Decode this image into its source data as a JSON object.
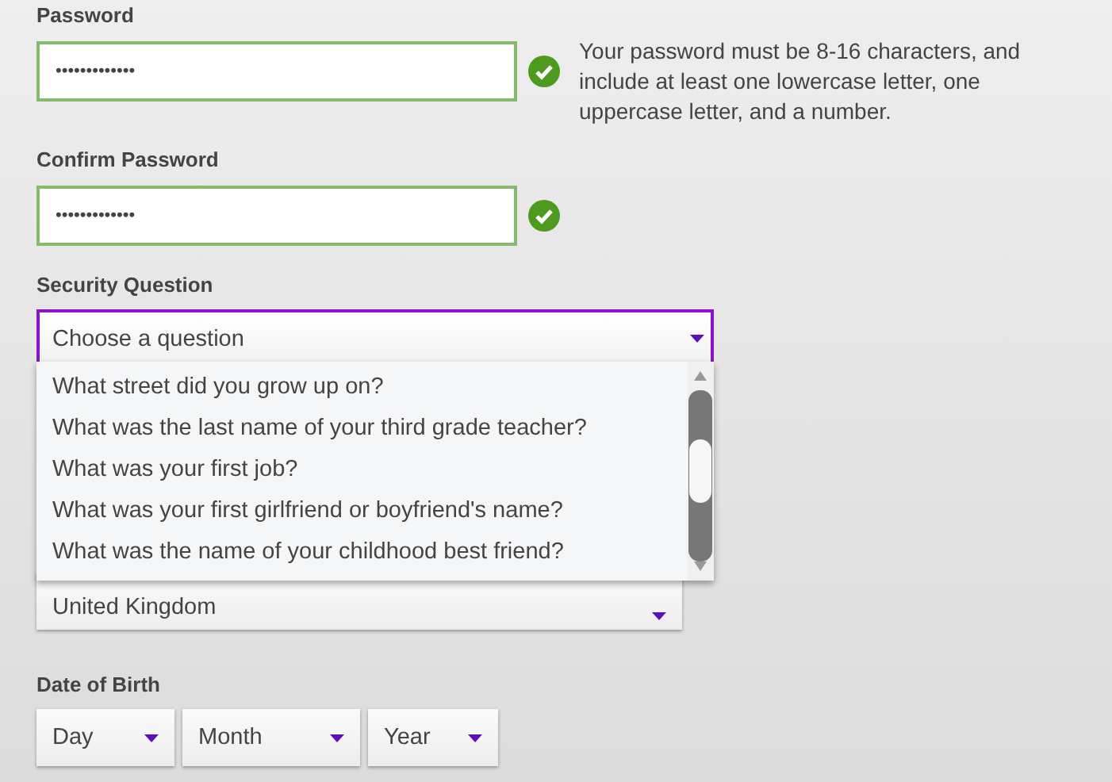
{
  "password_fields": [
    {
      "label": "Password",
      "value": "•••••••••••••",
      "valid": true,
      "hint": "Your password must be 8-16 characters, and include at least one lowercase letter, one uppercase letter, and a number."
    },
    {
      "label": "Confirm Password",
      "value": "•••••••••••••",
      "valid": true
    }
  ],
  "security_question": {
    "label": "Security Question",
    "value": "Choose a question",
    "expanded": true,
    "options": [
      {
        "label": "What street did you grow up on?",
        "selected": false
      },
      {
        "label": "What was the last name of your third grade teacher?",
        "selected": false
      },
      {
        "label": "What was your first job?",
        "selected": false
      },
      {
        "label": "What was your first girlfriend or boyfriend's name?",
        "selected": false
      },
      {
        "label": "What was the name of your childhood best friend?",
        "selected": false
      }
    ]
  },
  "country_select": {
    "value": "United Kingdom"
  },
  "date_of_birth": {
    "label": "Date of Birth",
    "selects": [
      {
        "value": "Day"
      },
      {
        "value": "Month"
      },
      {
        "value": "Year"
      }
    ]
  }
}
